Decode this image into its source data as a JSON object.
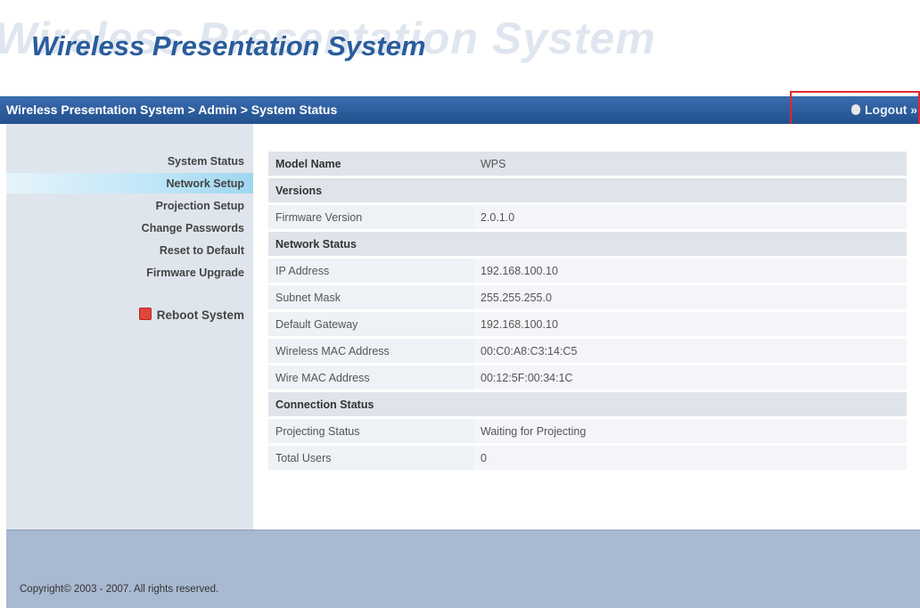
{
  "header": {
    "title": "Wireless Presentation System",
    "ghost_text": "Wireless Presentation System"
  },
  "navbar": {
    "breadcrumb": "Wireless Presentation System > Admin > System Status",
    "logout_label": "Logout »"
  },
  "sidebar": {
    "items": [
      {
        "label": "System Status"
      },
      {
        "label": "Network Setup"
      },
      {
        "label": "Projection Setup"
      },
      {
        "label": "Change Passwords"
      },
      {
        "label": "Reset to Default"
      },
      {
        "label": "Firmware Upgrade"
      }
    ],
    "reboot_label": "Reboot System",
    "active_item": "Network Setup"
  },
  "status": {
    "model_label": "Model Name",
    "model_value": "WPS",
    "versions_header": "Versions",
    "firmware_label": "Firmware Version",
    "firmware_value": "2.0.1.0",
    "network_header": "Network Status",
    "ip_label": "IP Address",
    "ip_value": "192.168.100.10",
    "subnet_label": "Subnet Mask",
    "subnet_value": "255.255.255.0",
    "gateway_label": "Default Gateway",
    "gateway_value": "192.168.100.10",
    "wmac_label": "Wireless MAC Address",
    "wmac_value": "00:C0:A8:C3:14:C5",
    "mac_label": "Wire MAC Address",
    "mac_value": "00:12:5F:00:34:1C",
    "connection_header": "Connection Status",
    "projecting_label": "Projecting Status",
    "projecting_value": "Waiting for Projecting",
    "users_label": "Total Users",
    "users_value": "0"
  },
  "footer": {
    "copyright": "Copyright© 2003 - 2007. All rights reserved."
  },
  "colors": {
    "brand_blue": "#2a5c9c",
    "navbar": "#22508e",
    "highlight_box": "#e0282e"
  }
}
